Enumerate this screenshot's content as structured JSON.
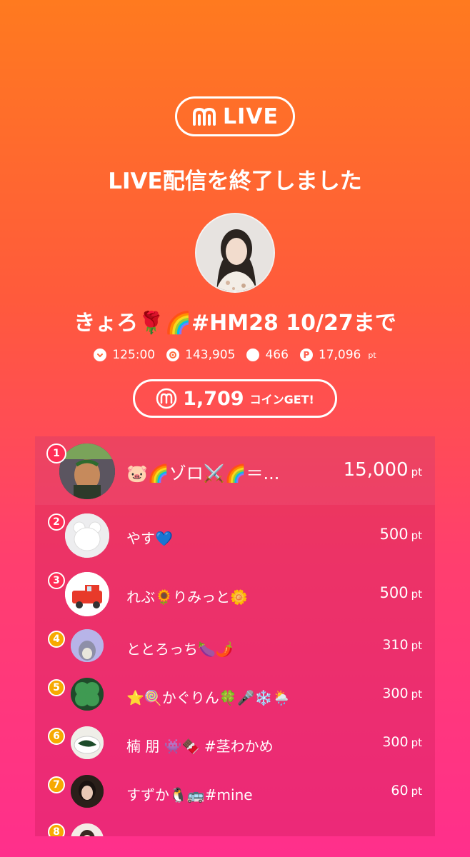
{
  "brand": {
    "logo_text": "LIVE"
  },
  "headline": "LIVE配信を終了しました",
  "streamer": {
    "name": "きょろ🌹🌈#HM28 10/27まで"
  },
  "stats": [
    {
      "icon": "clock-icon",
      "value": "125:00",
      "unit": ""
    },
    {
      "icon": "viewers-icon",
      "value": "143,905",
      "unit": ""
    },
    {
      "icon": "comment-icon",
      "value": "466",
      "unit": ""
    },
    {
      "icon": "points-icon",
      "value": "17,096",
      "unit": "pt"
    }
  ],
  "coins": {
    "amount": "1,709",
    "label": "コインGET!"
  },
  "ranking": [
    {
      "rank": "1",
      "name": "🐷🌈ゾロ⚔️🌈＝...",
      "points": "15,000",
      "unit": "pt"
    },
    {
      "rank": "2",
      "name": "やす💙",
      "points": "500",
      "unit": "pt"
    },
    {
      "rank": "3",
      "name": "れぶ🌻りみっと🌼",
      "points": "500",
      "unit": "pt"
    },
    {
      "rank": "4",
      "name": "ととろっち🍆🌶️",
      "points": "310",
      "unit": "pt"
    },
    {
      "rank": "5",
      "name": "⭐🍭かぐりん🍀🎤❄️🌦️",
      "points": "300",
      "unit": "pt"
    },
    {
      "rank": "6",
      "name": "楠 朋 👾🍫 #茎わかめ",
      "points": "300",
      "unit": "pt"
    },
    {
      "rank": "7",
      "name": "すずか🐧🚌#mine",
      "points": "60",
      "unit": "pt"
    },
    {
      "rank": "8",
      "name": "",
      "points": "",
      "unit": ""
    }
  ],
  "colors": {
    "gradient_top": "#ff7a1f",
    "gradient_bottom": "#ff2f8c",
    "rank_badge_top3": "#ff2d55",
    "rank_badge_other": "#f7a900"
  }
}
